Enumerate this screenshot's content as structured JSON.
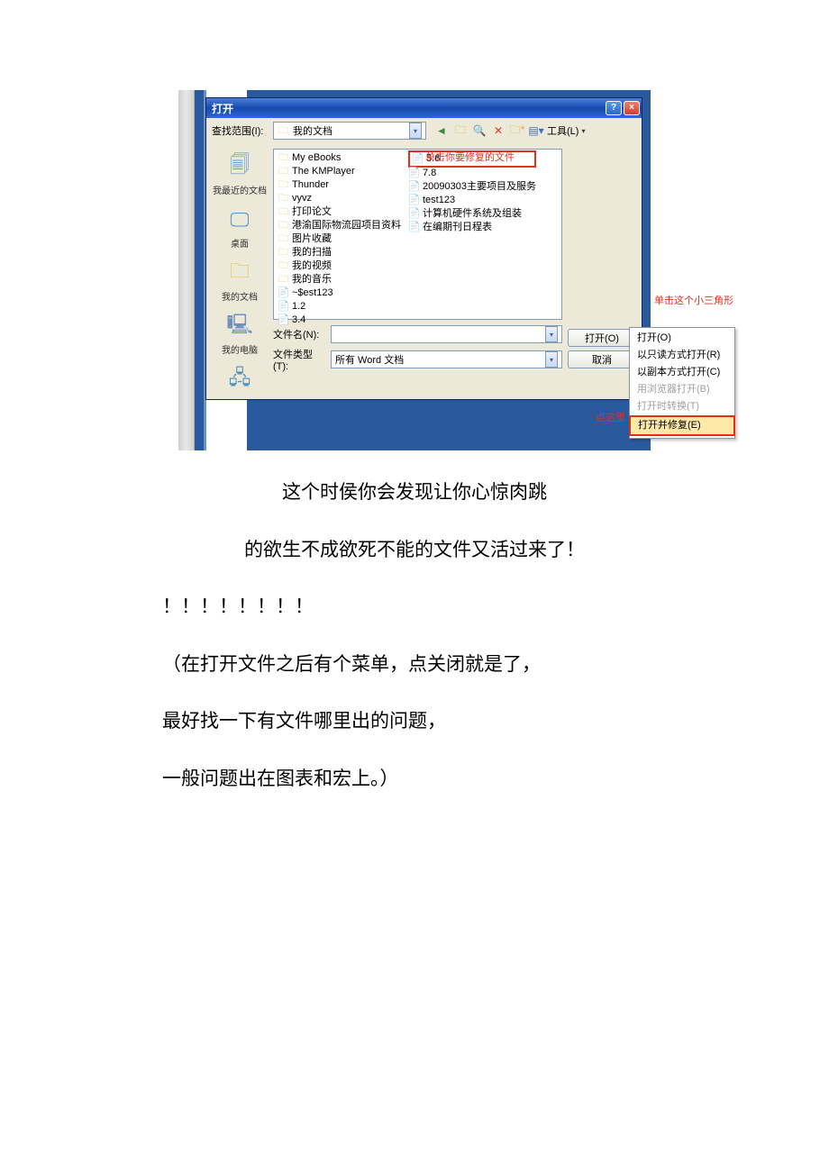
{
  "dialog": {
    "title": "打开",
    "help_btn": "?",
    "close_btn": "×",
    "lookin_label": "查找范围(I):",
    "lookin_value": "我的文档",
    "tools_label": "工具(L)",
    "filename_label": "文件名(N):",
    "filename_value": "",
    "filetype_label": "文件类型(T):",
    "filetype_value": "所有 Word 文档",
    "open_btn": "打开(O)",
    "cancel_btn": "取消"
  },
  "places": {
    "recent": "我最近的文档",
    "desktop": "桌面",
    "mydocs": "我的文档",
    "mycomputer": "我的电脑",
    "network": ""
  },
  "files_col1": [
    {
      "icon": "folder",
      "name": "My eBooks"
    },
    {
      "icon": "folder",
      "name": "The KMPlayer"
    },
    {
      "icon": "folder",
      "name": "Thunder"
    },
    {
      "icon": "folder",
      "name": "vyvz"
    },
    {
      "icon": "folder",
      "name": "打印论文"
    },
    {
      "icon": "folder",
      "name": "港渝国际物流园项目资料"
    },
    {
      "icon": "folder",
      "name": "图片收藏"
    },
    {
      "icon": "folder",
      "name": "我的扫描"
    },
    {
      "icon": "folder",
      "name": "我的视频"
    },
    {
      "icon": "folder",
      "name": "我的音乐"
    },
    {
      "icon": "doc",
      "name": "~$est123"
    },
    {
      "icon": "doc",
      "name": "1.2"
    },
    {
      "icon": "doc",
      "name": "3.4"
    }
  ],
  "files_col2": [
    {
      "icon": "doc",
      "name": "5.6",
      "highlight": true
    },
    {
      "icon": "doc",
      "name": "7.8"
    },
    {
      "icon": "doc",
      "name": "20090303主要项目及服务"
    },
    {
      "icon": "doc",
      "name": "test123"
    },
    {
      "icon": "doc",
      "name": "计算机硬件系统及组装"
    },
    {
      "icon": "doc",
      "name": "在编期刊日程表"
    }
  ],
  "menu": {
    "open": "打开(O)",
    "readonly": "以只读方式打开(R)",
    "copy": "以副本方式打开(C)",
    "browser": "用浏览器打开(B)",
    "transform": "打开时转换(T)",
    "repair": "打开并修复(E)"
  },
  "annot": {
    "click_file": "单击你要修复的文件",
    "click_tri": "单击这个小三角形",
    "click_here": "点这里"
  },
  "text": {
    "l1": "这个时侯你会发现让你心惊肉跳",
    "l2": "的欲生不成欲死不能的文件又活过来了！",
    "l3": "！！！！！！！！",
    "l4": "（在打开文件之后有个菜单，点关闭就是了，",
    "l5": "最好找一下有文件哪里出的问题，",
    "l6": "一般问题出在图表和宏上。）"
  }
}
